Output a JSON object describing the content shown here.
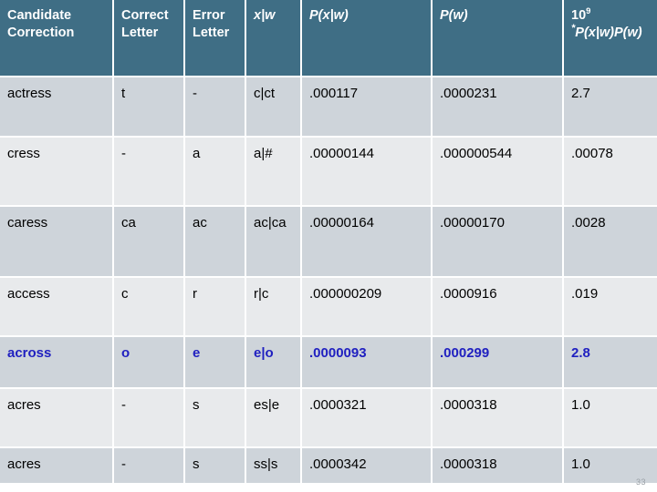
{
  "table": {
    "headers": [
      {
        "id": "candidate-correction",
        "label": "Candidate Correction",
        "italic": false
      },
      {
        "id": "correct-letter",
        "label": "Correct Letter",
        "italic": false
      },
      {
        "id": "error-letter",
        "label": "Error Letter",
        "italic": false
      },
      {
        "id": "x-given-w",
        "label": "x|w",
        "italic": true
      },
      {
        "id": "p-x-given-w",
        "label": "P(x|w)",
        "italic": true
      },
      {
        "id": "p-w",
        "label": "P(w)",
        "italic": true
      },
      {
        "id": "scaled-product",
        "label": "109*P(x|w)P(w)",
        "italic": true
      }
    ],
    "header_scaled": {
      "base": "10",
      "exponent": "9",
      "star": "*",
      "formula": "P(x|w)P(w)"
    },
    "rows": [
      {
        "candidate": "actress",
        "correct_letter": "t",
        "error_letter": "-",
        "x_given_w": "c|ct",
        "p_x_given_w": ".000117",
        "p_w": ".0000231",
        "scaled": "2.7",
        "highlight": false,
        "shade": "dark"
      },
      {
        "candidate": "cress",
        "correct_letter": "-",
        "error_letter": "a",
        "x_given_w": "a|#",
        "p_x_given_w": ".00000144",
        "p_w": ".000000544",
        "scaled": ".00078",
        "highlight": false,
        "shade": "light"
      },
      {
        "candidate": "caress",
        "correct_letter": "ca",
        "error_letter": "ac",
        "x_given_w": "ac|ca",
        "p_x_given_w": ".00000164",
        "p_w": ".00000170",
        "scaled": ".0028",
        "highlight": false,
        "shade": "dark"
      },
      {
        "candidate": "access",
        "correct_letter": "c",
        "error_letter": "r",
        "x_given_w": "r|c",
        "p_x_given_w": ".000000209",
        "p_w": ".0000916",
        "scaled": ".019",
        "highlight": false,
        "shade": "light"
      },
      {
        "candidate": "across",
        "correct_letter": "o",
        "error_letter": "e",
        "x_given_w": "e|o",
        "p_x_given_w": ".0000093",
        "p_w": ".000299",
        "scaled": "2.8",
        "highlight": true,
        "shade": "dark"
      },
      {
        "candidate": "acres",
        "correct_letter": "-",
        "error_letter": "s",
        "x_given_w": "es|e",
        "p_x_given_w": ".0000321",
        "p_w": ".0000318",
        "scaled": "1.0",
        "highlight": false,
        "shade": "light"
      },
      {
        "candidate": "acres",
        "correct_letter": "-",
        "error_letter": "s",
        "x_given_w": "ss|s",
        "p_x_given_w": ".0000342",
        "p_w": ".0000318",
        "scaled": "1.0",
        "highlight": false,
        "shade": "dark"
      }
    ]
  },
  "page_number": "33",
  "colors": {
    "header_background": "#3f6e85",
    "header_text": "#ffffff",
    "row_dark": "#ced4da",
    "row_light": "#e8eaec",
    "highlight_text": "#2020c0",
    "body_text": "#000000",
    "page_number_text": "#9aa0a6"
  }
}
